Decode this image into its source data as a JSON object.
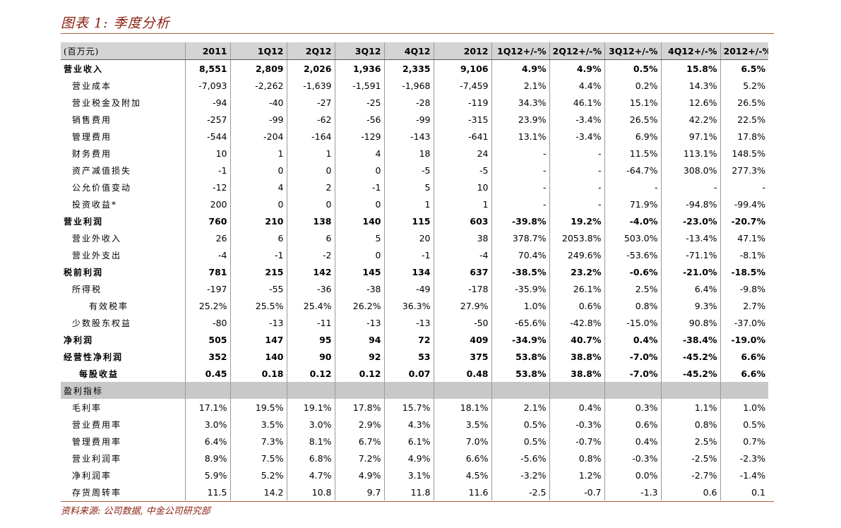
{
  "title": "图表 1: 季度分析",
  "source": "资料来源: 公司数据, 中金公司研究部",
  "table": {
    "headers": [
      "(百万元)",
      "2011",
      "1Q12",
      "2Q12",
      "3Q12",
      "4Q12",
      "2012",
      "1Q12+/-%",
      "2Q12+/-%",
      "3Q12+/-%",
      "4Q12+/-%",
      "2012+/-%"
    ],
    "rows": [
      {
        "label": "营业收入",
        "indent": 0,
        "style": "bold",
        "cells": [
          "8,551",
          "2,809",
          "2,026",
          "1,936",
          "2,335",
          "9,106",
          "4.9%",
          "4.9%",
          "0.5%",
          "15.8%",
          "6.5%"
        ]
      },
      {
        "label": "营业成本",
        "indent": 1,
        "style": "normal",
        "cells": [
          "-7,093",
          "-2,262",
          "-1,639",
          "-1,591",
          "-1,968",
          "-7,459",
          "2.1%",
          "4.4%",
          "0.2%",
          "14.3%",
          "5.2%"
        ]
      },
      {
        "label": "营业税金及附加",
        "indent": 1,
        "style": "normal",
        "cells": [
          "-94",
          "-40",
          "-27",
          "-25",
          "-28",
          "-119",
          "34.3%",
          "46.1%",
          "15.1%",
          "12.6%",
          "26.5%"
        ]
      },
      {
        "label": "销售费用",
        "indent": 1,
        "style": "normal",
        "cells": [
          "-257",
          "-99",
          "-62",
          "-56",
          "-99",
          "-315",
          "23.9%",
          "-3.4%",
          "26.5%",
          "42.2%",
          "22.5%"
        ]
      },
      {
        "label": "管理费用",
        "indent": 1,
        "style": "normal",
        "cells": [
          "-544",
          "-204",
          "-164",
          "-129",
          "-143",
          "-641",
          "13.1%",
          "-3.4%",
          "6.9%",
          "97.1%",
          "17.8%"
        ]
      },
      {
        "label": "财务费用",
        "indent": 1,
        "style": "normal",
        "cells": [
          "10",
          "1",
          "1",
          "4",
          "18",
          "24",
          "-",
          "-",
          "11.5%",
          "113.1%",
          "148.5%"
        ]
      },
      {
        "label": "资产减值损失",
        "indent": 1,
        "style": "normal",
        "cells": [
          "-1",
          "0",
          "0",
          "0",
          "-5",
          "-5",
          "-",
          "-",
          "-64.7%",
          "308.0%",
          "277.3%"
        ]
      },
      {
        "label": "公允价值变动",
        "indent": 1,
        "style": "normal",
        "cells": [
          "-12",
          "4",
          "2",
          "-1",
          "5",
          "10",
          "-",
          "-",
          "-",
          "-",
          "-"
        ]
      },
      {
        "label": "投资收益*",
        "indent": 1,
        "style": "normal",
        "cells": [
          "200",
          "0",
          "0",
          "0",
          "1",
          "1",
          "-",
          "-",
          "71.9%",
          "-94.8%",
          "-99.4%"
        ]
      },
      {
        "label": "营业利润",
        "indent": 0,
        "style": "bold",
        "cells": [
          "760",
          "210",
          "138",
          "140",
          "115",
          "603",
          "-39.8%",
          "19.2%",
          "-4.0%",
          "-23.0%",
          "-20.7%"
        ]
      },
      {
        "label": "营业外收入",
        "indent": 1,
        "style": "normal",
        "cells": [
          "26",
          "6",
          "6",
          "5",
          "20",
          "38",
          "378.7%",
          "2053.8%",
          "503.0%",
          "-13.4%",
          "47.1%"
        ]
      },
      {
        "label": "营业外支出",
        "indent": 1,
        "style": "normal",
        "cells": [
          "-4",
          "-1",
          "-2",
          "0",
          "-1",
          "-4",
          "70.4%",
          "249.6%",
          "-53.6%",
          "-71.1%",
          "-8.1%"
        ]
      },
      {
        "label": "税前利润",
        "indent": 0,
        "style": "bold",
        "cells": [
          "781",
          "215",
          "142",
          "145",
          "134",
          "637",
          "-38.5%",
          "23.2%",
          "-0.6%",
          "-21.0%",
          "-18.5%"
        ]
      },
      {
        "label": "所得税",
        "indent": 1,
        "style": "normal",
        "cells": [
          "-197",
          "-55",
          "-36",
          "-38",
          "-49",
          "-178",
          "-35.9%",
          "26.1%",
          "2.5%",
          "6.4%",
          "-9.8%"
        ]
      },
      {
        "label": "有效税率",
        "indent": 4,
        "style": "normal",
        "cells": [
          "25.2%",
          "25.5%",
          "25.4%",
          "26.2%",
          "36.3%",
          "27.9%",
          "1.0%",
          "0.6%",
          "0.8%",
          "9.3%",
          "2.7%"
        ]
      },
      {
        "label": "少数股东权益",
        "indent": 1,
        "style": "normal",
        "cells": [
          "-80",
          "-13",
          "-11",
          "-13",
          "-13",
          "-50",
          "-65.6%",
          "-42.8%",
          "-15.0%",
          "90.8%",
          "-37.0%"
        ]
      },
      {
        "label": "净利润",
        "indent": 0,
        "style": "bold",
        "cells": [
          "505",
          "147",
          "95",
          "94",
          "72",
          "409",
          "-34.9%",
          "40.7%",
          "0.4%",
          "-38.4%",
          "-19.0%"
        ]
      },
      {
        "label": "经营性净利润",
        "indent": 0,
        "style": "bold",
        "cells": [
          "352",
          "140",
          "90",
          "92",
          "53",
          "375",
          "53.8%",
          "38.8%",
          "-7.0%",
          "-45.2%",
          "6.6%"
        ]
      },
      {
        "label": "每股收益",
        "indent": 2,
        "style": "bold",
        "cells": [
          "0.45",
          "0.18",
          "0.12",
          "0.12",
          "0.07",
          "0.48",
          "53.8%",
          "38.8%",
          "-7.0%",
          "-45.2%",
          "6.6%"
        ]
      },
      {
        "label": "盈利指标",
        "indent": 0,
        "style": "section",
        "cells": [
          "",
          "",
          "",
          "",
          "",
          "",
          "",
          "",
          "",
          "",
          ""
        ]
      },
      {
        "label": "毛利率",
        "indent": 1,
        "style": "normal",
        "cells": [
          "17.1%",
          "19.5%",
          "19.1%",
          "17.8%",
          "15.7%",
          "18.1%",
          "2.1%",
          "0.4%",
          "0.3%",
          "1.1%",
          "1.0%"
        ]
      },
      {
        "label": "营业费用率",
        "indent": 1,
        "style": "normal",
        "cells": [
          "3.0%",
          "3.5%",
          "3.0%",
          "2.9%",
          "4.3%",
          "3.5%",
          "0.5%",
          "-0.3%",
          "0.6%",
          "0.8%",
          "0.5%"
        ]
      },
      {
        "label": "管理费用率",
        "indent": 1,
        "style": "normal",
        "cells": [
          "6.4%",
          "7.3%",
          "8.1%",
          "6.7%",
          "6.1%",
          "7.0%",
          "0.5%",
          "-0.7%",
          "0.4%",
          "2.5%",
          "0.7%"
        ]
      },
      {
        "label": "营业利润率",
        "indent": 1,
        "style": "normal",
        "cells": [
          "8.9%",
          "7.5%",
          "6.8%",
          "7.2%",
          "4.9%",
          "6.6%",
          "-5.6%",
          "0.8%",
          "-0.3%",
          "-2.5%",
          "-2.3%"
        ]
      },
      {
        "label": "净利润率",
        "indent": 1,
        "style": "normal",
        "cells": [
          "5.9%",
          "5.2%",
          "4.7%",
          "4.9%",
          "3.1%",
          "4.5%",
          "-3.2%",
          "1.2%",
          "0.0%",
          "-2.7%",
          "-1.4%"
        ]
      },
      {
        "label": "存货周转率",
        "indent": 1,
        "style": "normal",
        "cells": [
          "11.5",
          "14.2",
          "10.8",
          "9.7",
          "11.8",
          "11.6",
          "-2.5",
          "-0.7",
          "-1.3",
          "0.6",
          "0.1"
        ]
      }
    ]
  }
}
